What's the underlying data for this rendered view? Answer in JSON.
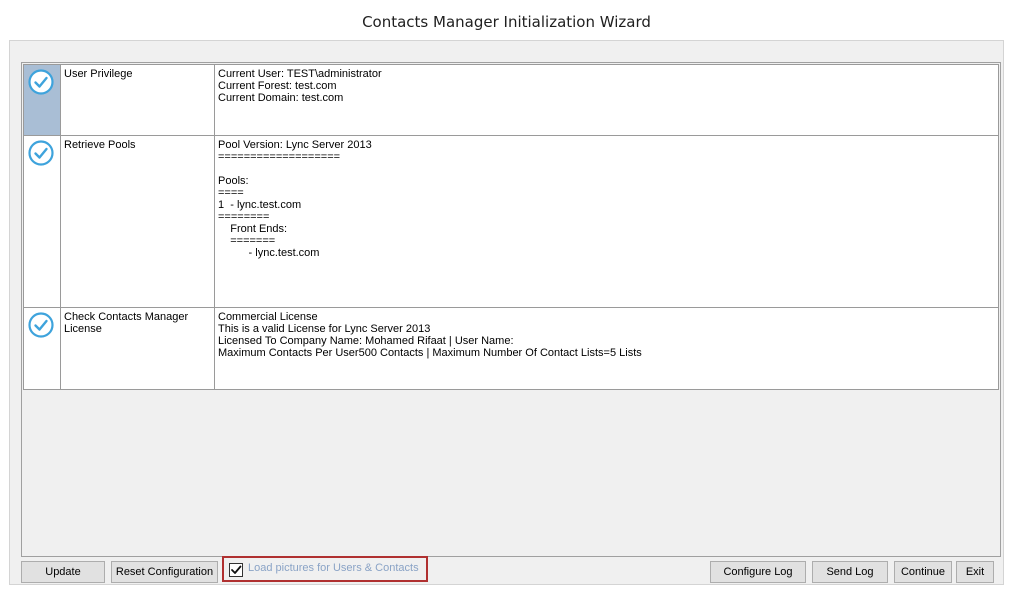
{
  "window": {
    "title": "Contacts Manager Initialization Wizard"
  },
  "steps": [
    {
      "name": "User Privilege",
      "status_icon": "check-circle-icon",
      "selected": true,
      "details": "Current User: TEST\\administrator\nCurrent Forest: test.com\nCurrent Domain: test.com"
    },
    {
      "name": "Retrieve Pools",
      "status_icon": "check-circle-icon",
      "selected": false,
      "details": "Pool Version: Lync Server 2013\n===================\n\nPools:\n====\n1  - lync.test.com\n========\n    Front Ends:\n    =======\n          - lync.test.com\n "
    },
    {
      "name": "Check Contacts Manager License",
      "status_icon": "check-circle-icon",
      "selected": false,
      "details": "Commercial License\nThis is a valid License for Lync Server 2013\nLicensed To Company Name: Mohamed Rifaat | User Name:\nMaximum Contacts Per User500 Contacts | Maximum Number Of Contact Lists=5 Lists\n "
    }
  ],
  "buttons": {
    "update": "Update",
    "reset": "Reset Configuration",
    "configure_log": "Configure Log",
    "send_log": "Send Log",
    "continue": "Continue",
    "exit": "Exit"
  },
  "load_pictures": {
    "label": "Load pictures for Users & Contacts",
    "checked": true
  },
  "colors": {
    "check_icon": "#3ea3dc",
    "selected_row": "#a9bed5",
    "highlight_border": "#b03030"
  }
}
